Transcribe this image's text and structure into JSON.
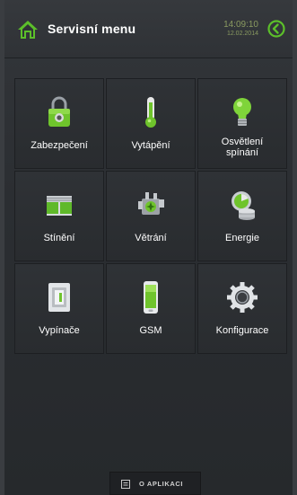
{
  "header": {
    "title": "Servisní menu",
    "time": "14:09:10",
    "date": "12.02.2014",
    "home_icon": "home-icon",
    "back_icon": "back-arrow-icon"
  },
  "tiles": [
    {
      "label": "Zabezpečení",
      "icon": "padlock-icon"
    },
    {
      "label": "Vytápění",
      "icon": "thermometer-icon"
    },
    {
      "label": "Osvětlení spínání",
      "icon": "lightbulb-icon"
    },
    {
      "label": "Stínění",
      "icon": "window-blind-icon"
    },
    {
      "label": "Větrání",
      "icon": "ventilation-unit-icon"
    },
    {
      "label": "Energie",
      "icon": "energy-meter-icon"
    },
    {
      "label": "Vypínače",
      "icon": "wall-switch-icon"
    },
    {
      "label": "GSM",
      "icon": "phone-icon"
    },
    {
      "label": "Konfigurace",
      "icon": "gear-icon"
    }
  ],
  "footer": {
    "about_label": "O APLIKACI",
    "icon": "note-icon"
  },
  "colors": {
    "accent_green": "#5cbf2a",
    "clock_text": "#8a9a60",
    "background": "#2b2e32"
  }
}
